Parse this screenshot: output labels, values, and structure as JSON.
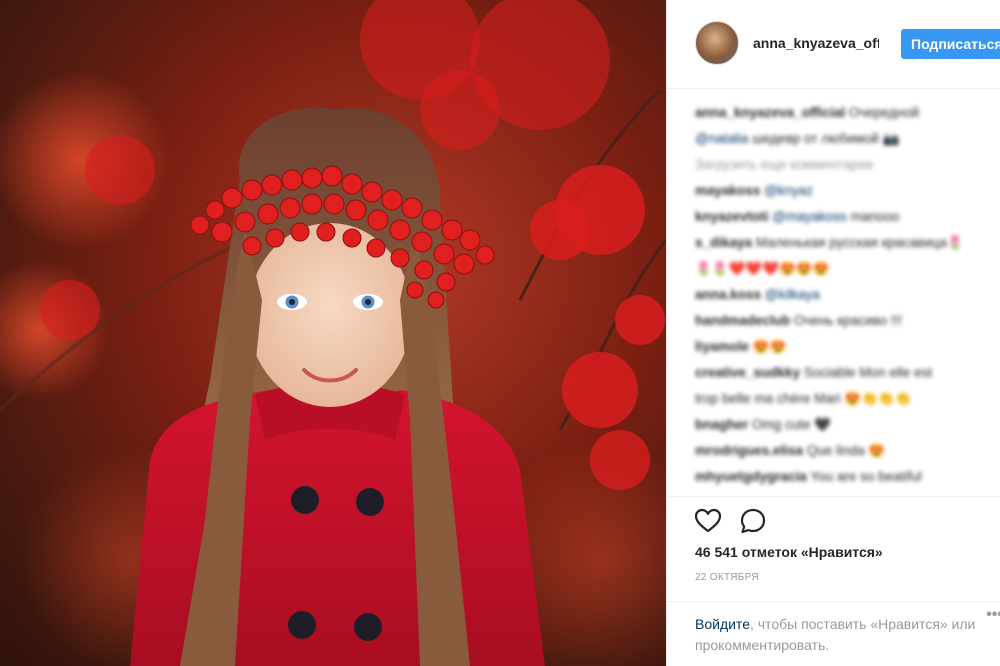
{
  "post": {
    "username": "anna_knyazeva_official",
    "follow_label": "Подписаться",
    "photo_alt": "portrait-photo"
  },
  "comments": [
    {
      "user": "anna_knyazeva_official",
      "text": "Очередной",
      "mention": ""
    },
    {
      "user": "",
      "text": "шедевр от любимой 📷",
      "mention": "@natalia"
    },
    {
      "user": "",
      "text": "Загрузить еще комментарии",
      "mention": "",
      "kind": "load-more"
    },
    {
      "user": "mayakoss",
      "text": "",
      "mention": "@knyaz"
    },
    {
      "user": "knyazevtoti",
      "text": "manooo",
      "mention": "@mayakoss"
    },
    {
      "user": "s_dikaya",
      "text": "Маленькая русская красавица🌷",
      "mention": ""
    },
    {
      "user": "",
      "text": "🌷🌷❤️❤️❤️😍😍😍",
      "mention": ""
    },
    {
      "user": "anna.koss",
      "text": "",
      "mention": "@kilkaya"
    },
    {
      "user": "handmadeclub",
      "text": "Очень красиво !!!",
      "mention": ""
    },
    {
      "user": "liyamole",
      "text": "😍😍",
      "mention": ""
    },
    {
      "user": "creative_sudkky",
      "text": "Sociable Mon elle est",
      "mention": ""
    },
    {
      "user": "",
      "text": "trop belle ma chère Mari 😍👏👏👏",
      "mention": ""
    },
    {
      "user": "bnagher",
      "text": "Omg cute 🖤",
      "mention": ""
    },
    {
      "user": "mrodrigues.elisa",
      "text": "Que linda 😍",
      "mention": ""
    },
    {
      "user": "mhyuetgdygracia",
      "text": "You are so beatiful",
      "mention": ""
    },
    {
      "user": "",
      "text": "———————",
      "mention": ""
    }
  ],
  "actions": {
    "like_icon": "heart-icon",
    "comment_icon": "speech-bubble-icon",
    "likes_text": "46 541 отметок «Нравится»",
    "date": "22 ОКТЯБРЯ"
  },
  "login_prompt": {
    "link": "Войдите",
    "rest": ", чтобы поставить «Нравится» или прокомментировать.",
    "more": "•••"
  },
  "colors": {
    "follow_button": "#3897f0",
    "link": "#003569",
    "muted": "#999999",
    "coat": "#c8102e",
    "berries": "#d81d1d"
  }
}
